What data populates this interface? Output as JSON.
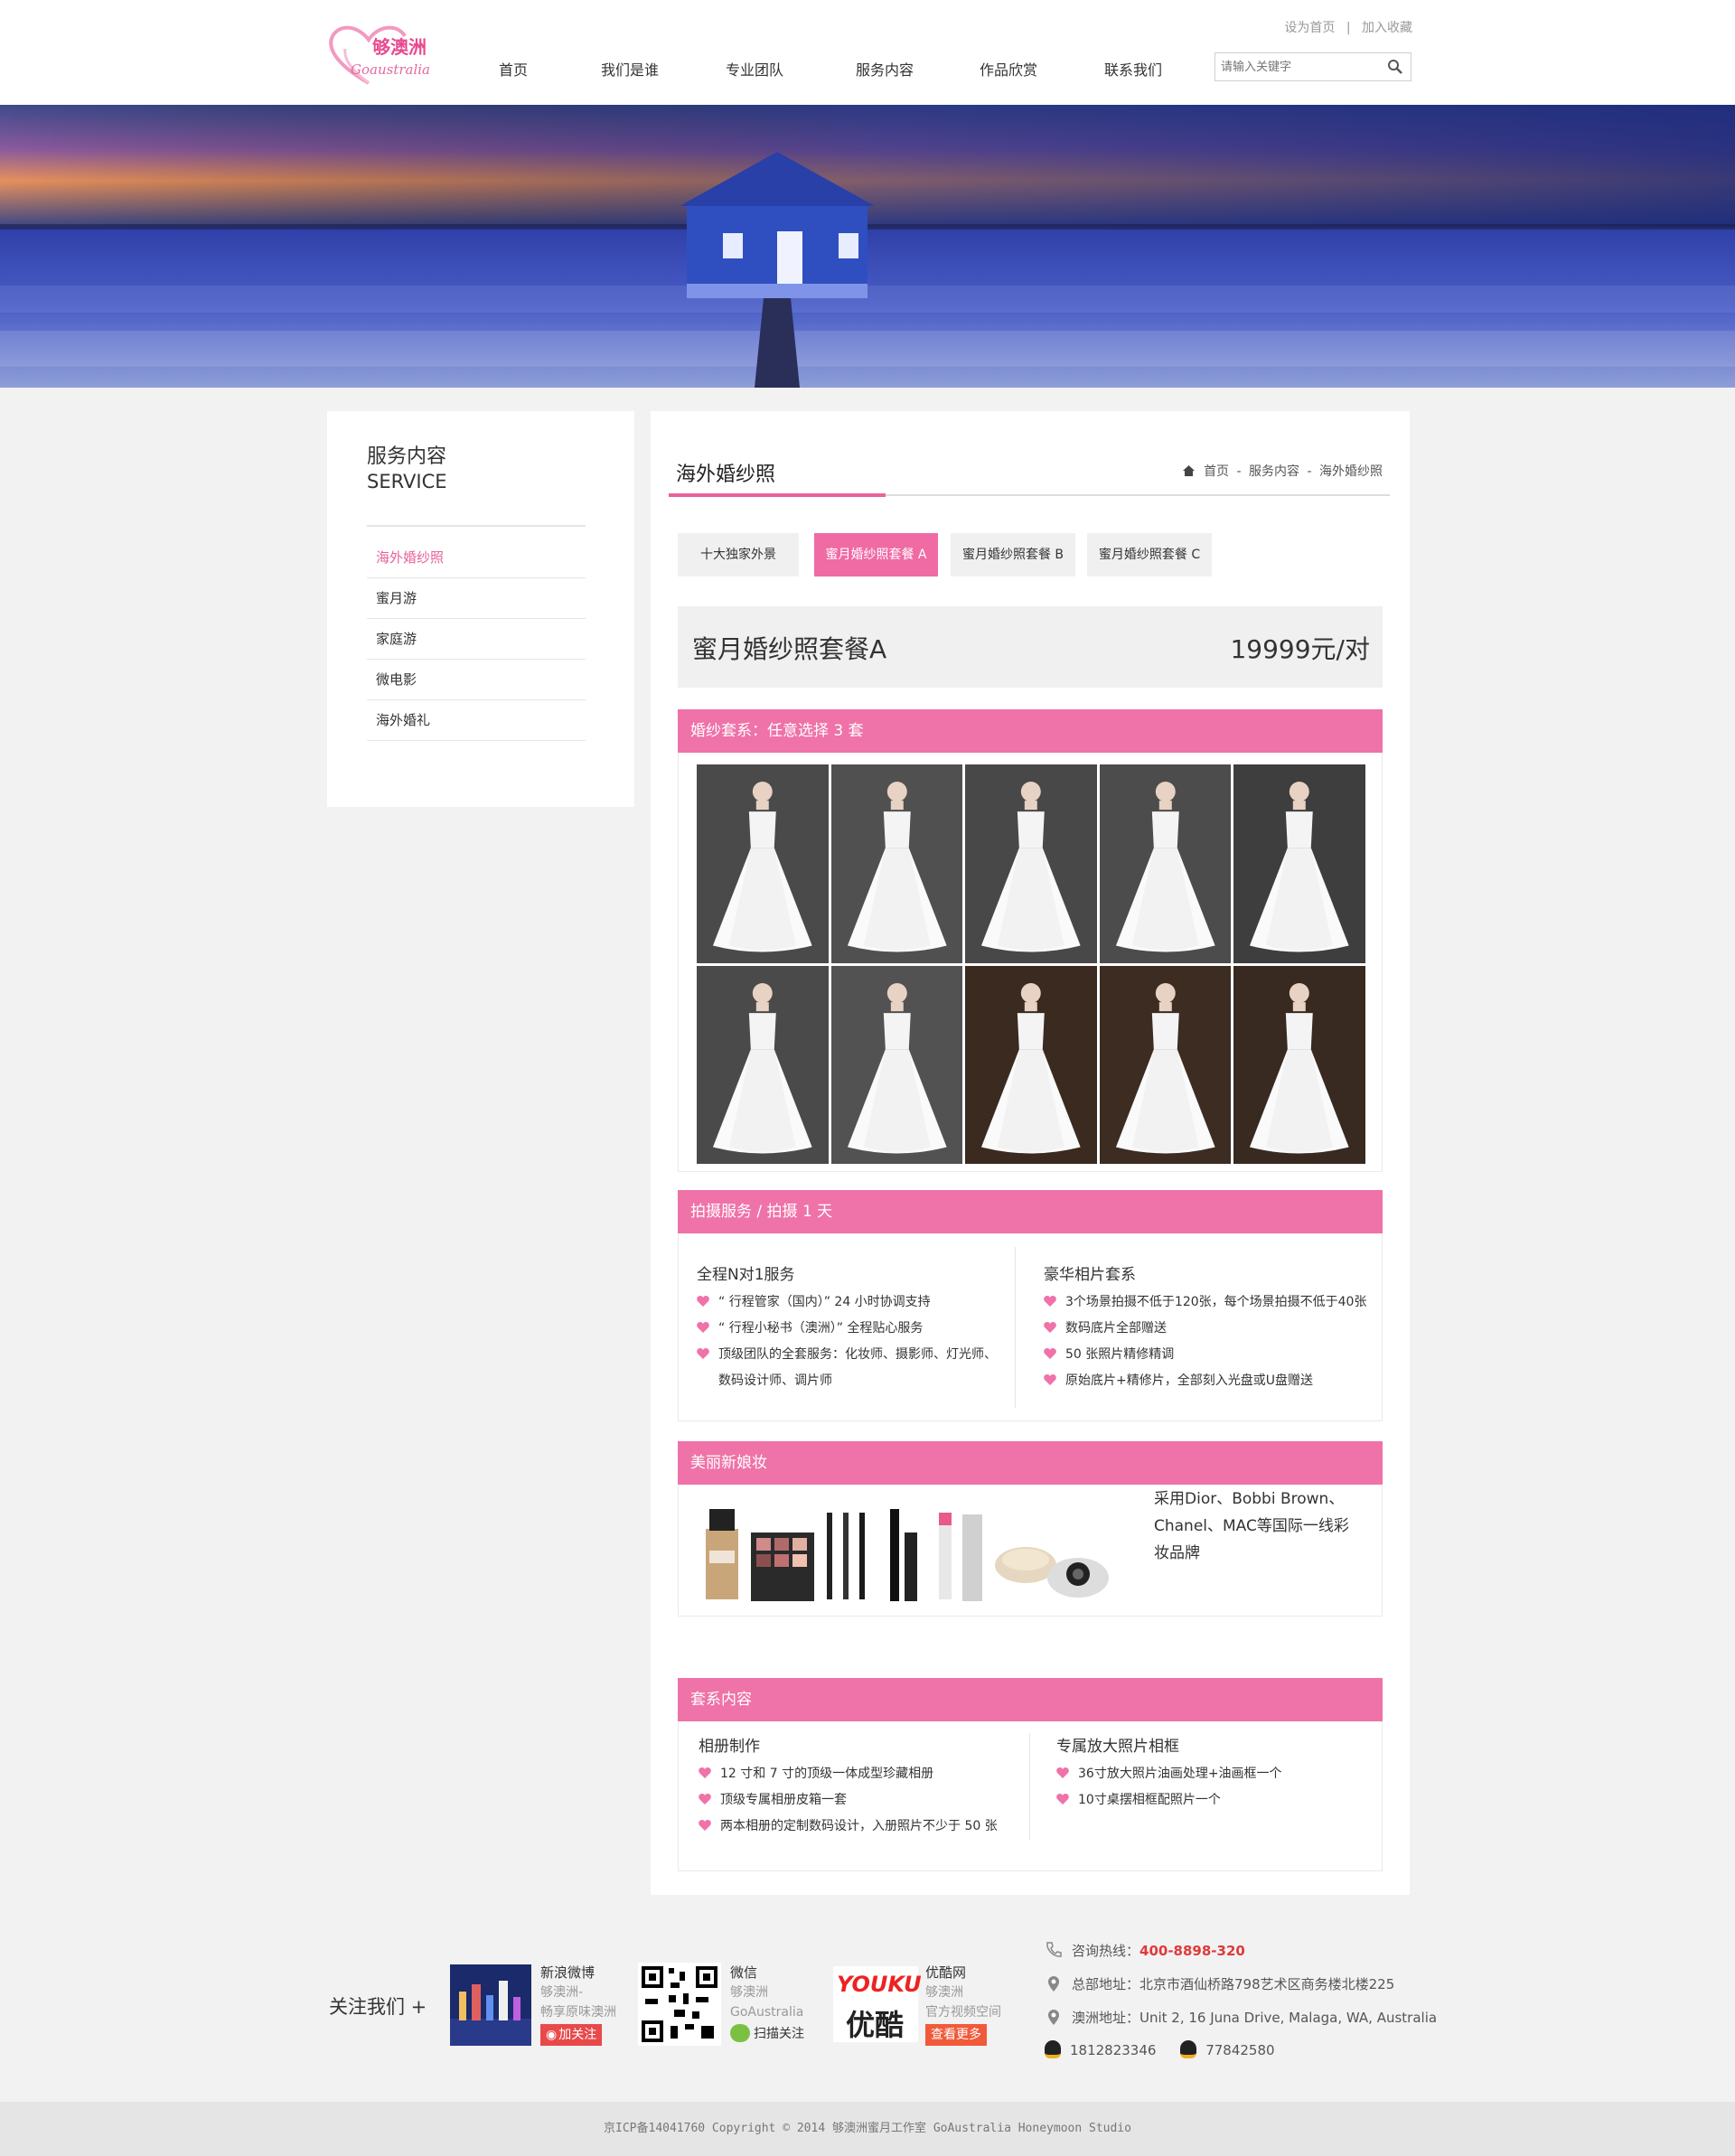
{
  "brand": {
    "cn": "够澳洲",
    "en": "Goaustralia"
  },
  "nav": {
    "items": [
      "首页",
      "我们是谁",
      "专业团队",
      "服务内容",
      "作品欣赏",
      "联系我们"
    ]
  },
  "toplinks": {
    "home": "设为首页",
    "sep": "|",
    "fav": "加入收藏"
  },
  "search": {
    "placeholder": "请输入关键字"
  },
  "sidebar": {
    "title": "服务内容",
    "subtitle": "SERVICE",
    "items": [
      "海外婚纱照",
      "蜜月游",
      "家庭游",
      "微电影",
      "海外婚礼"
    ]
  },
  "main": {
    "title": "海外婚纱照",
    "breadcrumb": {
      "home": "首页",
      "sep": "-",
      "level1": "服务内容",
      "level2": "海外婚纱照"
    },
    "tabs": [
      "十大独家外景",
      "蜜月婚纱照套餐 A",
      "蜜月婚纱照套餐 B",
      "蜜月婚纱照套餐 C"
    ],
    "package": {
      "name": "蜜月婚纱照套餐A",
      "price": "19999元/对"
    },
    "sec_dress": {
      "title": "婚纱套系：任意选择 3 套"
    },
    "sec_shoot": {
      "title": "拍摄服务 / 拍摄 1 天",
      "left_title": "全程N对1服务",
      "left_items": [
        "“ 行程管家（国内）” 24 小时协调支持",
        "“ 行程小秘书（澳洲）” 全程贴心服务",
        "顶级团队的全套服务：化妆师、摄影师、灯光师、",
        "数码设计师、调片师"
      ],
      "right_title": "豪华相片套系",
      "right_items": [
        "3个场景拍摄不低于120张，每个场景拍摄不低于40张",
        "数码底片全部赠送",
        "50 张照片精修精调",
        "原始底片+精修片，全部刻入光盘或U盘赠送"
      ]
    },
    "sec_makeup": {
      "title": "美丽新娘妆",
      "text": "采用Dior、Bobbi Brown、Chanel、MAC等国际一线彩妆品牌"
    },
    "sec_set": {
      "title": "套系内容",
      "left_title": "相册制作",
      "left_items": [
        "12 寸和 7 寸的顶级一体成型珍藏相册",
        "顶级专属相册皮箱一套",
        "两本相册的定制数码设计，入册照片不少于 50 张"
      ],
      "right_title": "专属放大照片相框",
      "right_items": [
        "36寸放大照片油画处理+油画框一个",
        "10寸桌摆相框配照片一个"
      ]
    }
  },
  "footer": {
    "follow": "关注我们 +",
    "weibo": {
      "name": "新浪微博",
      "desc1": "够澳洲-",
      "desc2": "畅享原味澳洲",
      "btn": "加关注"
    },
    "weixin": {
      "name": "微信",
      "desc1": "够澳洲",
      "desc2": "GoAustralia",
      "btn": "扫描关注"
    },
    "youku": {
      "name": "优酷网",
      "desc1": "够澳洲",
      "desc2": "官方视频空间",
      "btn": "查看更多",
      "logo_en": "YOUKU",
      "logo_cn": "优酷"
    },
    "hotline_label": "咨询热线：",
    "hotline": "400-8898-320",
    "addr_cn": "总部地址：北京市酒仙桥路798艺术区商务楼北楼225",
    "addr_au": "澳洲地址：Unit 2, 16 Juna Drive, Malaga, WA, Australia",
    "qq1": "1812823346",
    "qq2": "77842580",
    "copyright": "京ICP备14041760   Copyright © 2014   够澳洲蜜月工作室   GoAustralia Honeymoon Studio"
  },
  "colors": {
    "accent": "#ef72a8",
    "hotline": "#e03a3a"
  }
}
